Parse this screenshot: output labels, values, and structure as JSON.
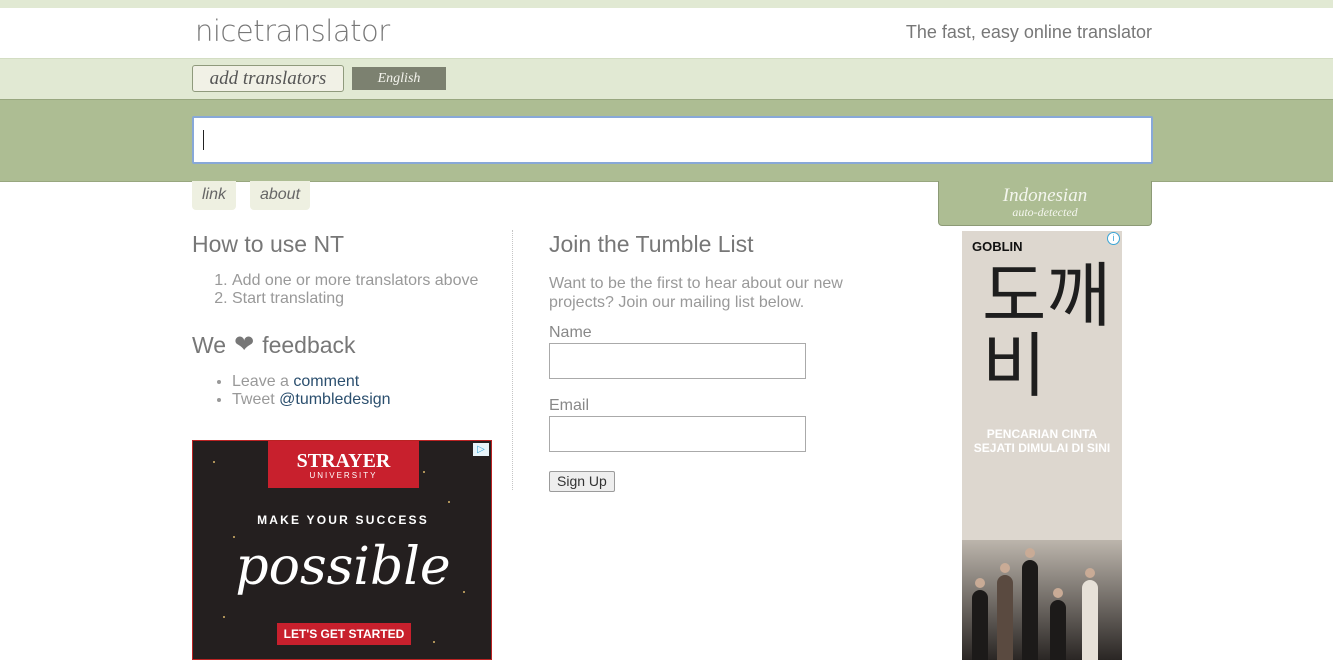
{
  "header": {
    "logo": "nicetranslator",
    "tagline": "The fast, easy online translator"
  },
  "toolbar": {
    "add_label": "add translators",
    "language_label": "English"
  },
  "search": {
    "value": ""
  },
  "tabs": [
    {
      "label": "link"
    },
    {
      "label": "about"
    }
  ],
  "detected": {
    "language": "Indonesian",
    "note": "auto-detected"
  },
  "how_to": {
    "title": "How to use NT",
    "steps": [
      "Add one or more translators above",
      "Start translating"
    ]
  },
  "feedback": {
    "title_pre": "We",
    "title_post": "feedback",
    "items": [
      {
        "prefix": "Leave a",
        "link": "comment"
      },
      {
        "prefix": "Tweet",
        "link": "@tumbledesign"
      }
    ]
  },
  "tumble": {
    "title": "Join the Tumble List",
    "intro": "Want to be the first to hear about our new projects? Join our mailing list below.",
    "name_label": "Name",
    "email_label": "Email",
    "signup_label": "Sign Up"
  },
  "ad_left": {
    "brand": "STRAYER",
    "sub": "UNIVERSITY",
    "headline": "MAKE YOUR SUCCESS",
    "script": "possible",
    "cta": "LET'S GET STARTED"
  },
  "ad_right": {
    "brand": "GOBLIN",
    "calligraphy": "도깨비",
    "tagline_1": "PENCARIAN CINTA",
    "tagline_2": "SEJATI DIMULAI DI SINI"
  }
}
